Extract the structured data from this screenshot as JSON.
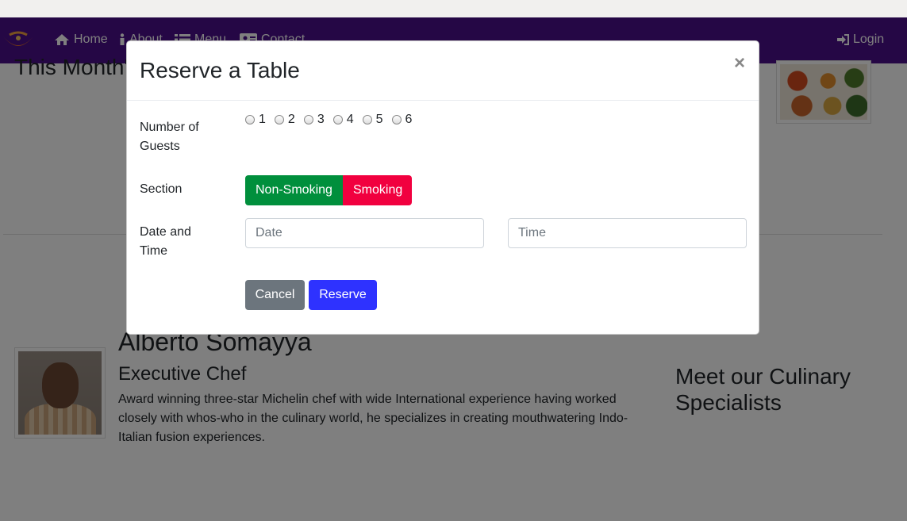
{
  "nav": {
    "items": [
      {
        "label": "Home",
        "icon": "home-icon"
      },
      {
        "label": "About",
        "icon": "info-icon"
      },
      {
        "label": "Menu",
        "icon": "list-icon"
      },
      {
        "label": "Contact",
        "icon": "address-card-icon"
      }
    ],
    "login_label": "Login"
  },
  "page": {
    "promo_title": "This Month's Promotions",
    "chef": {
      "name": "Alberto Somayya",
      "role": "Executive Chef",
      "description": "Award winning three-star Michelin chef with wide International experience having worked closely with whos-who in the culinary world, he specializes in creating mouthwatering Indo-Italian fusion experiences."
    },
    "meet_title": "Meet our Culinary Specialists"
  },
  "modal": {
    "title": "Reserve a Table",
    "close_label": "×",
    "guests_label": "Number of Guests",
    "guest_options": [
      "1",
      "2",
      "3",
      "4",
      "5",
      "6"
    ],
    "section_label": "Section",
    "non_smoking_label": "Non-Smoking",
    "smoking_label": "Smoking",
    "datetime_label": "Date and Time",
    "date_placeholder": "Date",
    "time_placeholder": "Time",
    "cancel_label": "Cancel",
    "reserve_label": "Reserve"
  },
  "colors": {
    "navbar": "#4b0f8a",
    "non_smoking": "#008f3c",
    "smoking": "#f1003f",
    "reserve": "#2e32ff",
    "cancel": "#6c757d"
  }
}
